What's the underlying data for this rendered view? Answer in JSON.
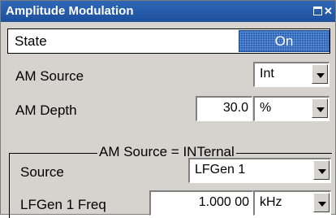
{
  "window": {
    "title": "Amplitude Modulation"
  },
  "state": {
    "label": "State",
    "value": "On"
  },
  "am_source": {
    "label": "AM Source",
    "value": "Int"
  },
  "am_depth": {
    "label": "AM Depth",
    "value": "30.0",
    "unit": "%"
  },
  "group": {
    "title": "AM Source = INTernal",
    "source": {
      "label": "Source",
      "value": "LFGen 1"
    },
    "freq": {
      "label": "LFGen 1 Freq",
      "value": "1.000 00",
      "unit": "kHz"
    }
  }
}
